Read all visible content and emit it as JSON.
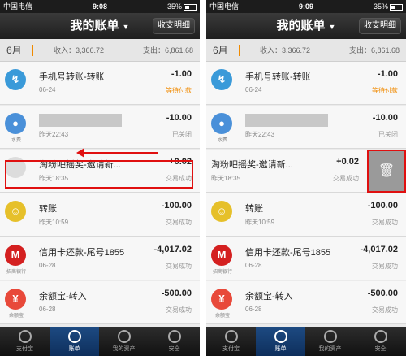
{
  "status": {
    "carrier": "中国电信",
    "time": "9:08",
    "battery": "35%",
    "left_time": "9:08",
    "right_time": "9:09"
  },
  "header": {
    "title": "我的账单",
    "caret": "▼",
    "detail_button": "收支明细"
  },
  "summary": {
    "month": "6月",
    "income": "收入：3,366.72",
    "expense": "支出：6,861.68"
  },
  "rows": [
    {
      "icon": "↯",
      "icon_label": "",
      "name": "手机号转账-转账",
      "date": "06-24",
      "amount": "-1.00",
      "status": "等待付款",
      "pending": true,
      "color": "#3a9ad9"
    },
    {
      "icon": "💧",
      "icon_label": "水费",
      "name": "",
      "date": "昨天22:43",
      "amount": "-10.00",
      "status": "已关闭",
      "pending": false,
      "color": "#4a90d9"
    },
    {
      "icon": "",
      "icon_label": "",
      "name": "淘粉吧摇奖-邀请新...",
      "date": "昨天18:35",
      "amount": "+0.02",
      "status": "交易成功",
      "pending": false,
      "color": "#dcdcdc"
    },
    {
      "icon": "☺",
      "icon_label": "",
      "name": "转账",
      "date": "昨天10:59",
      "amount": "-100.00",
      "status": "交易成功",
      "pending": false,
      "color": "#e6c02a"
    },
    {
      "icon": "M",
      "icon_label": "招商银行",
      "name": "信用卡还款-尾号1855",
      "date": "06-28",
      "amount": "-4,017.02",
      "status": "交易成功",
      "pending": false,
      "color": "#d42020"
    },
    {
      "icon": "¥",
      "icon_label": "余额宝",
      "name": "余额宝-转入",
      "date": "06-28",
      "amount": "-500.00",
      "status": "交易成功",
      "pending": false,
      "color": "#e8493a"
    }
  ],
  "tabs": [
    "支付宝",
    "账单",
    "我的资产",
    "安全"
  ],
  "delete_icon": "trash-icon",
  "colors": {
    "pending": "#f08a00",
    "highlight": "#e01010",
    "tab_active": "#1d4a82"
  }
}
